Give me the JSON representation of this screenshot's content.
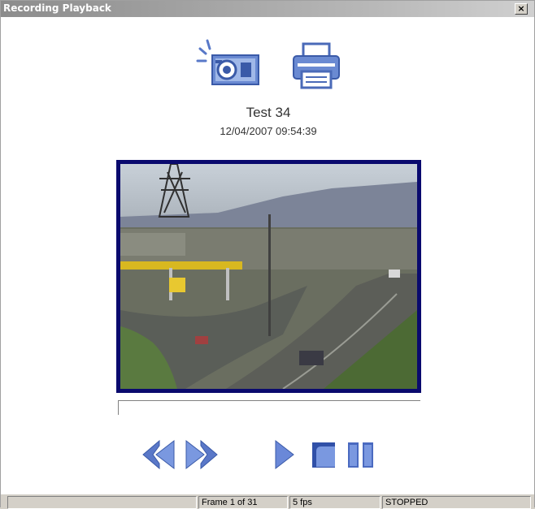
{
  "window": {
    "title": "Recording Playback",
    "close_label": "×"
  },
  "toolbar": {
    "snapshot_icon": "camera-flash-icon",
    "print_icon": "printer-icon"
  },
  "recording": {
    "name": "Test 34",
    "datetime": "12/04/2007 09:54:39"
  },
  "controls": [
    "rewind-icon",
    "fast-forward-icon",
    "play-icon",
    "stop-icon",
    "pause-icon"
  ],
  "status": {
    "panel1": "",
    "frame": "Frame 1 of 31",
    "fps": "5 fps",
    "state": "STOPPED"
  },
  "colors": {
    "icon_blue": "#5070c0",
    "frame_border": "#0a0a6e"
  }
}
